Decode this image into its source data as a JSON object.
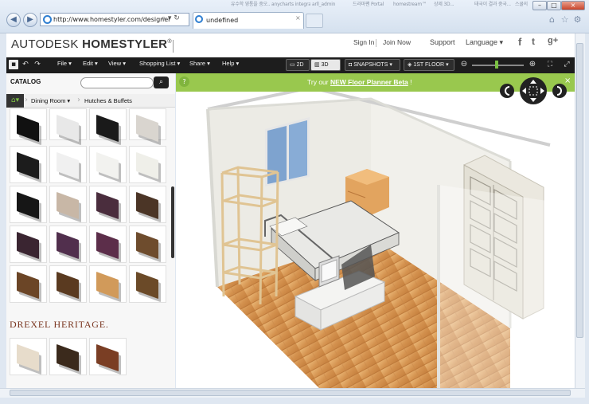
{
  "browser": {
    "url": "http://www.homestyler.com/designer",
    "tab_title": "undefined",
    "other_tabs": [
      "유수학 영통을 중오...",
      "anycharts integration",
      "arll_admin",
      "드라마팬 Portal",
      "homestream™",
      "상제 3D...",
      "태국이 결과 중국...",
      "스쿨의"
    ],
    "window_buttons": [
      "–",
      "□",
      "×"
    ],
    "icons": [
      "home-icon",
      "star-icon",
      "gear-icon"
    ]
  },
  "header": {
    "logo_prefix": "AUTODESK",
    "logo_main": "HOMESTYLER",
    "logo_mark": "®",
    "sign_in": "Sign In",
    "join_now": "Join Now",
    "support": "Support",
    "language": "Language ▾",
    "social": [
      "f",
      "t",
      "g+"
    ]
  },
  "toolbar": {
    "menus": [
      "File",
      "Edit",
      "View",
      "Shopping List",
      "Share",
      "Help"
    ],
    "view_2d": "2D",
    "view_3d": "3D",
    "snapshots": "SNAPSHOTS",
    "floor": "1ST FLOOR",
    "zoom_level": 0.45
  },
  "catalog": {
    "title": "CATALOG",
    "search_placeholder": "",
    "crumbs": [
      "Dining Room ▾",
      "Hutches & Buffets"
    ],
    "brand": "DREXEL HERITAGE.",
    "colors": {
      "accent": "#99c84e",
      "toolbar": "#1d1d1d"
    }
  },
  "viewport": {
    "beta_prefix": "Try our",
    "beta_link": "NEW Floor Planner Beta",
    "beta_suffix": "!",
    "close": "×",
    "info": "?"
  }
}
